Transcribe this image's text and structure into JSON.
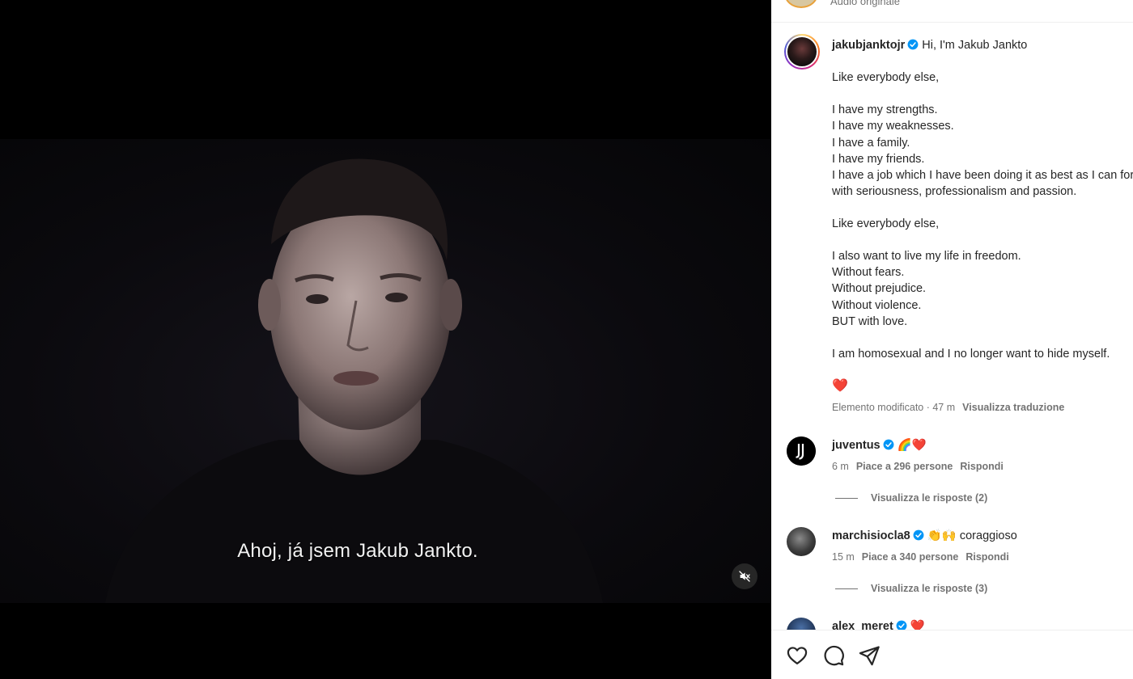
{
  "video": {
    "subtitle": "Ahoj, já jsem Jakub Jankto.",
    "mute_icon": "speaker-muted-icon"
  },
  "header": {
    "audio_label": "Audio originale"
  },
  "post": {
    "username": "jakubjanktojr",
    "verified": true,
    "caption_lines": [
      "Hi, I'm Jakub Jankto",
      "",
      "Like everybody else,",
      "",
      "I have my strengths.",
      "I have my weaknesses.",
      "I have a family.",
      "I have my friends.",
      "I have a job which I have been doing it as best as I can for years",
      "with seriousness, professionalism and passion.",
      "",
      "Like everybody else,",
      "",
      "I also want to live my life in freedom.",
      "Without fears.",
      "Without prejudice.",
      "Without violence.",
      "BUT with love.",
      "",
      "I am homosexual and I no longer want to hide myself.",
      "",
      "❤️"
    ],
    "edited_label": "Elemento modificato · 47 m",
    "translate_label": "Visualizza traduzione"
  },
  "comments": [
    {
      "username": "juventus",
      "verified": true,
      "text": "🌈❤️",
      "time": "6 m",
      "likes": "Piace a 296 persone",
      "reply": "Rispondi",
      "view_replies": "Visualizza le risposte (2)"
    },
    {
      "username": "marchisiocla8",
      "verified": true,
      "text": "👏🙌 coraggioso",
      "time": "15 m",
      "likes": "Piace a 340 persone",
      "reply": "Rispondi",
      "view_replies": "Visualizza le risposte (3)"
    },
    {
      "username": "alex_meret",
      "verified": true,
      "text": "❤️"
    }
  ],
  "actions": {
    "like_icon": "heart-icon",
    "comment_icon": "comment-icon",
    "share_icon": "share-icon"
  },
  "colors": {
    "verified_blue": "#0095f6",
    "heart_red": "#ed1c24",
    "text_primary": "#262626",
    "text_secondary": "#737373"
  }
}
